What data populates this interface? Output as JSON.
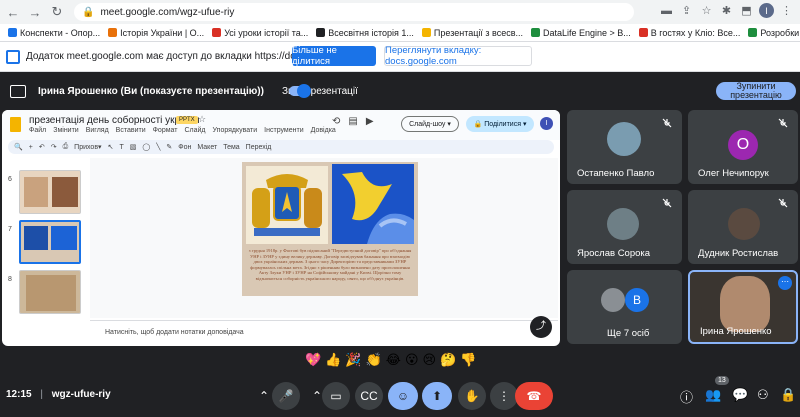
{
  "browser": {
    "url": "meet.google.com/wgz-ufue-riy",
    "profile_initial": "I"
  },
  "bookmarks": [
    {
      "label": "Конспекти - Опор...",
      "color": "#1a73e8"
    },
    {
      "label": "Історія України | О...",
      "color": "#e8710a"
    },
    {
      "label": "Усі уроки історії та...",
      "color": "#d93025"
    },
    {
      "label": "Всесвітня історія 1...",
      "color": "#202124"
    },
    {
      "label": "Презентації з всесв...",
      "color": "#f4b400"
    },
    {
      "label": "DataLife Engine > В...",
      "color": "#1e8e3e"
    },
    {
      "label": "В гостях у Кліо: Все...",
      "color": "#d93025"
    },
    {
      "label": "Розробки з історії...",
      "color": "#1e8e3e"
    }
  ],
  "infobar": {
    "message": "Додаток meet.google.com має доступ до вкладки https://docs.google.com",
    "primary": "Більше не ділитися",
    "secondary": "Переглянути вкладку: docs.google.com"
  },
  "presenting": {
    "label": "Ірина Ярошенко (Ви (показуєте презентацію))",
    "sound": "Звук презентації",
    "stop": "Зупинити презентацію"
  },
  "slides": {
    "title": "презентація день соборності україни",
    "badge": "PPTX",
    "menu": [
      "Файл",
      "Змінити",
      "Вигляд",
      "Вставити",
      "Формат",
      "Слайд",
      "Упорядкувати",
      "Інструменти",
      "Довідка"
    ],
    "slideshow": "Слайд-шоу",
    "share": "Поділитися",
    "user_initial": "I",
    "toolbar": [
      "Прихов",
      "Фон",
      "Макет",
      "Тема",
      "Перехід"
    ],
    "thumb_numbers": [
      "6",
      "7",
      "8"
    ],
    "slide_text": "з грудня 1918р. у Фастові був підписаний \"Передвступний договір\" про об'єднання УНР і ЗУНР у єдину велику державу. Договір засвідчував бажання про взаємодію двох українських держав. З цього часу Директорією та представниками ЗУНР формувалась спільна мета. Згідно з рішенням було визначено дату проголошення Акту Злуки УНР і ЗУНР на Софійському майдані у Києві. Щорічно тому відзначається соборність українського народу, свято, що об'єднує українців.",
    "notes": "Натисніть, щоб додати нотатки доповідача"
  },
  "participants": [
    {
      "name": "Остапенко Павло"
    },
    {
      "name": "Олег Нечипорук",
      "initial": "О"
    },
    {
      "name": "Ярослав Сорока"
    },
    {
      "name": "Дудник Ростислав"
    },
    {
      "name": "Ще 7 осіб",
      "initial": "В"
    },
    {
      "name": "Ірина Ярошенко"
    }
  ],
  "reactions": [
    "💖",
    "👍",
    "🎉",
    "👏",
    "😂",
    "😮",
    "😢",
    "🤔",
    "👎"
  ],
  "bottom": {
    "time": "12:15",
    "code": "wgz-ufue-riy",
    "people_count": "13"
  },
  "colors": {
    "meet_bg": "#202124",
    "tile_bg": "#3c4043",
    "accent_blue": "#8ab4f8",
    "end_call_red": "#ea4335"
  }
}
